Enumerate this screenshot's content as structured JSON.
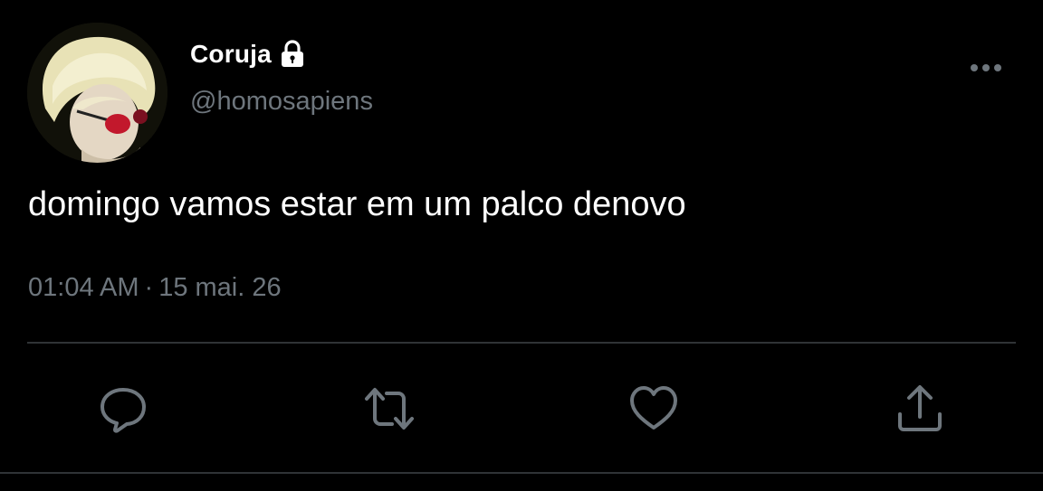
{
  "user": {
    "display_name": "Coruja",
    "handle": "@homosapiens",
    "protected_icon": "lock-icon",
    "avatar": "profile-photo"
  },
  "tweet": {
    "text": "domingo vamos estar em um palco denovo",
    "time": "01:04 AM",
    "separator": "·",
    "date": "15 mai. 26"
  },
  "actions": [
    {
      "name": "reply",
      "icon": "reply-icon"
    },
    {
      "name": "retweet",
      "icon": "retweet-icon"
    },
    {
      "name": "like",
      "icon": "heart-icon"
    },
    {
      "name": "share",
      "icon": "share-icon"
    }
  ],
  "menu": {
    "icon": "more-options-icon"
  },
  "colors": {
    "background": "#000000",
    "text_primary": "#ffffff",
    "text_secondary": "#6e767d",
    "divider": "#2f3336",
    "icon": "#6e767d"
  }
}
